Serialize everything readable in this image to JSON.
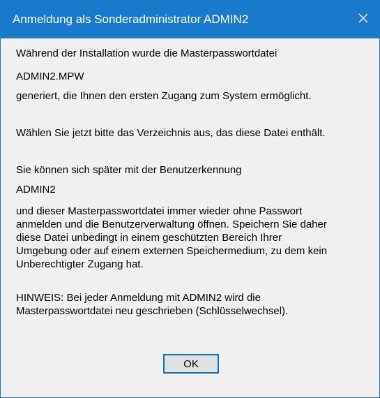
{
  "dialog": {
    "title": "Anmeldung als Sonderadministrator ADMIN2",
    "close_icon": "close-icon",
    "accent_color": "#1979ca",
    "paragraphs": {
      "p1_line1": "Während der Installation wurde die Masterpasswortdatei",
      "p1_filename": "ADMIN2.MPW",
      "p1_line3": "generiert, die Ihnen den ersten Zugang zum System ermöglicht.",
      "p2_line1": "Wählen Sie jetzt bitte das Verzeichnis aus, das diese Datei enthält.",
      "p3_line1": "Sie können sich später mit der Benutzerkennung",
      "p3_user": "ADMIN2",
      "p3_line3": "und dieser Masterpasswortdatei immer wieder ohne Passwort",
      "p3_line4": "anmelden und die Benutzerverwaltung öffnen. Speichern Sie daher",
      "p3_line5": "diese Datei unbedingt in einem geschützten Bereich Ihrer",
      "p3_line6": "Umgebung oder auf einem externen Speichermedium, zu dem kein",
      "p3_line7": "Unberechtigter Zugang hat.",
      "p4_line1": "HINWEIS: Bei jeder Anmeldung mit ADMIN2 wird die",
      "p4_line2": "Masterpasswortdatei neu geschrieben (Schlüsselwechsel)."
    },
    "ok_label": "OK"
  }
}
